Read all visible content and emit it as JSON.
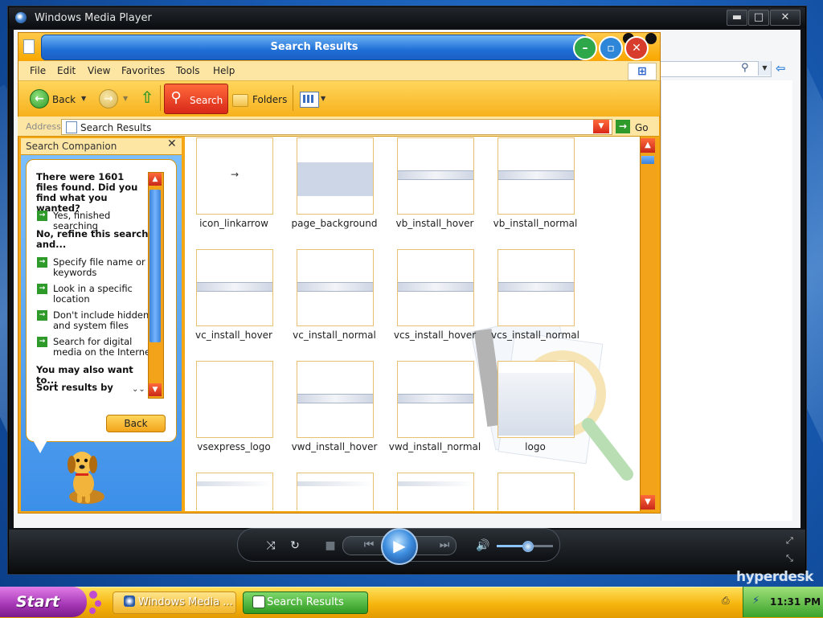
{
  "wmp": {
    "title": "Windows Media Player",
    "controls": {
      "minimize": "▬",
      "maximize": "□",
      "close": "✕"
    },
    "brand": "hyperdesk"
  },
  "explorer": {
    "title": "Search Results",
    "menu": [
      "File",
      "Edit",
      "View",
      "Favorites",
      "Tools",
      "Help"
    ],
    "toolbar": {
      "back": "Back",
      "search": "Search",
      "folders": "Folders"
    },
    "address": {
      "label": "Address",
      "value": "Search Results",
      "go": "Go"
    }
  },
  "search_companion": {
    "title": "Search Companion",
    "result_text": "There were 1601 files found. Did you find what you wanted?",
    "yes_option": "Yes, finished searching",
    "refine_heading": "No, refine this search and...",
    "refine_options": [
      "Specify file name or keywords",
      "Look in a specific location",
      "Don't include hidden and system files",
      "Search for digital media on the Internet"
    ],
    "also_heading": "You may also want to...",
    "sort_option": "Sort results by category",
    "back_button": "Back"
  },
  "files": [
    {
      "name": "icon_linkarrow",
      "preview": "arrow"
    },
    {
      "name": "page_background",
      "preview": "band"
    },
    {
      "name": "vb_install_hover",
      "preview": "banner"
    },
    {
      "name": "vb_install_normal",
      "preview": "banner"
    },
    {
      "name": "vc_install_hover",
      "preview": "banner"
    },
    {
      "name": "vc_install_normal",
      "preview": "banner"
    },
    {
      "name": "vcs_install_hover",
      "preview": "banner"
    },
    {
      "name": "vcs_install_normal",
      "preview": "banner"
    },
    {
      "name": "vsexpress_logo",
      "preview": "blank"
    },
    {
      "name": "vwd_install_hover",
      "preview": "banner"
    },
    {
      "name": "vwd_install_normal",
      "preview": "banner"
    },
    {
      "name": "logo",
      "preview": "logo"
    },
    {
      "name": "",
      "preview": "top"
    },
    {
      "name": "",
      "preview": "top"
    },
    {
      "name": "",
      "preview": "top"
    },
    {
      "name": "",
      "preview": "blank"
    }
  ],
  "taskbar": {
    "start": "Start",
    "tasks": [
      "Windows Media ...",
      "Search Results"
    ],
    "clock": "11:31 PM"
  },
  "colors": {
    "explorer_frame": "#f5a614",
    "title_blue": "#1f6fd6",
    "taskbar": "#f6b50e",
    "start": "#a436b4"
  }
}
